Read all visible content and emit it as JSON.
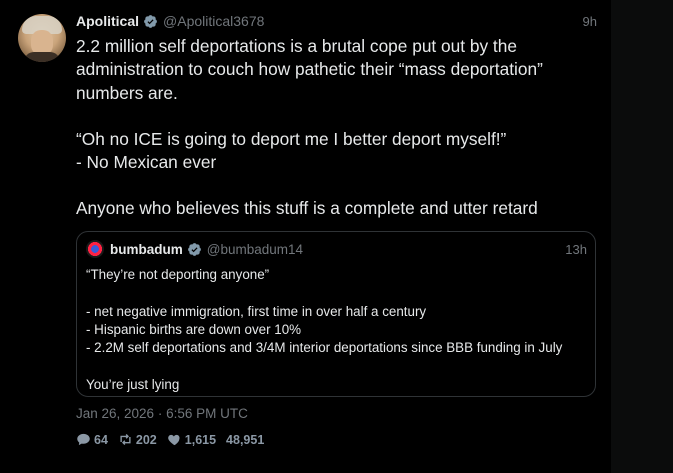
{
  "tweet": {
    "author": "Apolitical",
    "handle": "@Apolitical3678",
    "time": "9h",
    "paragraphs": [
      "2.2 million self deportations is a brutal cope put out by the administration to couch how pathetic their “mass deportation” numbers are.",
      "“Oh no ICE is going to deport me I better deport myself!”",
      "- No Mexican ever",
      "Anyone who believes this stuff is a complete and utter retard"
    ],
    "date": "Jan 26, 2026 · 6:56 PM UTC",
    "stats": {
      "replies": "64",
      "retweets": "202",
      "likes": "1,615",
      "views": "48,951"
    }
  },
  "quote": {
    "author": "bumbadum",
    "handle": "@bumbadum14",
    "time": "13h",
    "lines": [
      "“They’re not deporting anyone”",
      "- net negative immigration, first time in over half a century",
      "- Hispanic births are down over 10%",
      "- 2.2M self deportations and 3/4M interior deportations since BBB funding in July",
      "You’re just lying"
    ]
  },
  "colors": {
    "background": "#000000",
    "text": "#e7e9ea",
    "muted": "#71767b",
    "verified": "#829aab",
    "border": "#2f3336"
  }
}
